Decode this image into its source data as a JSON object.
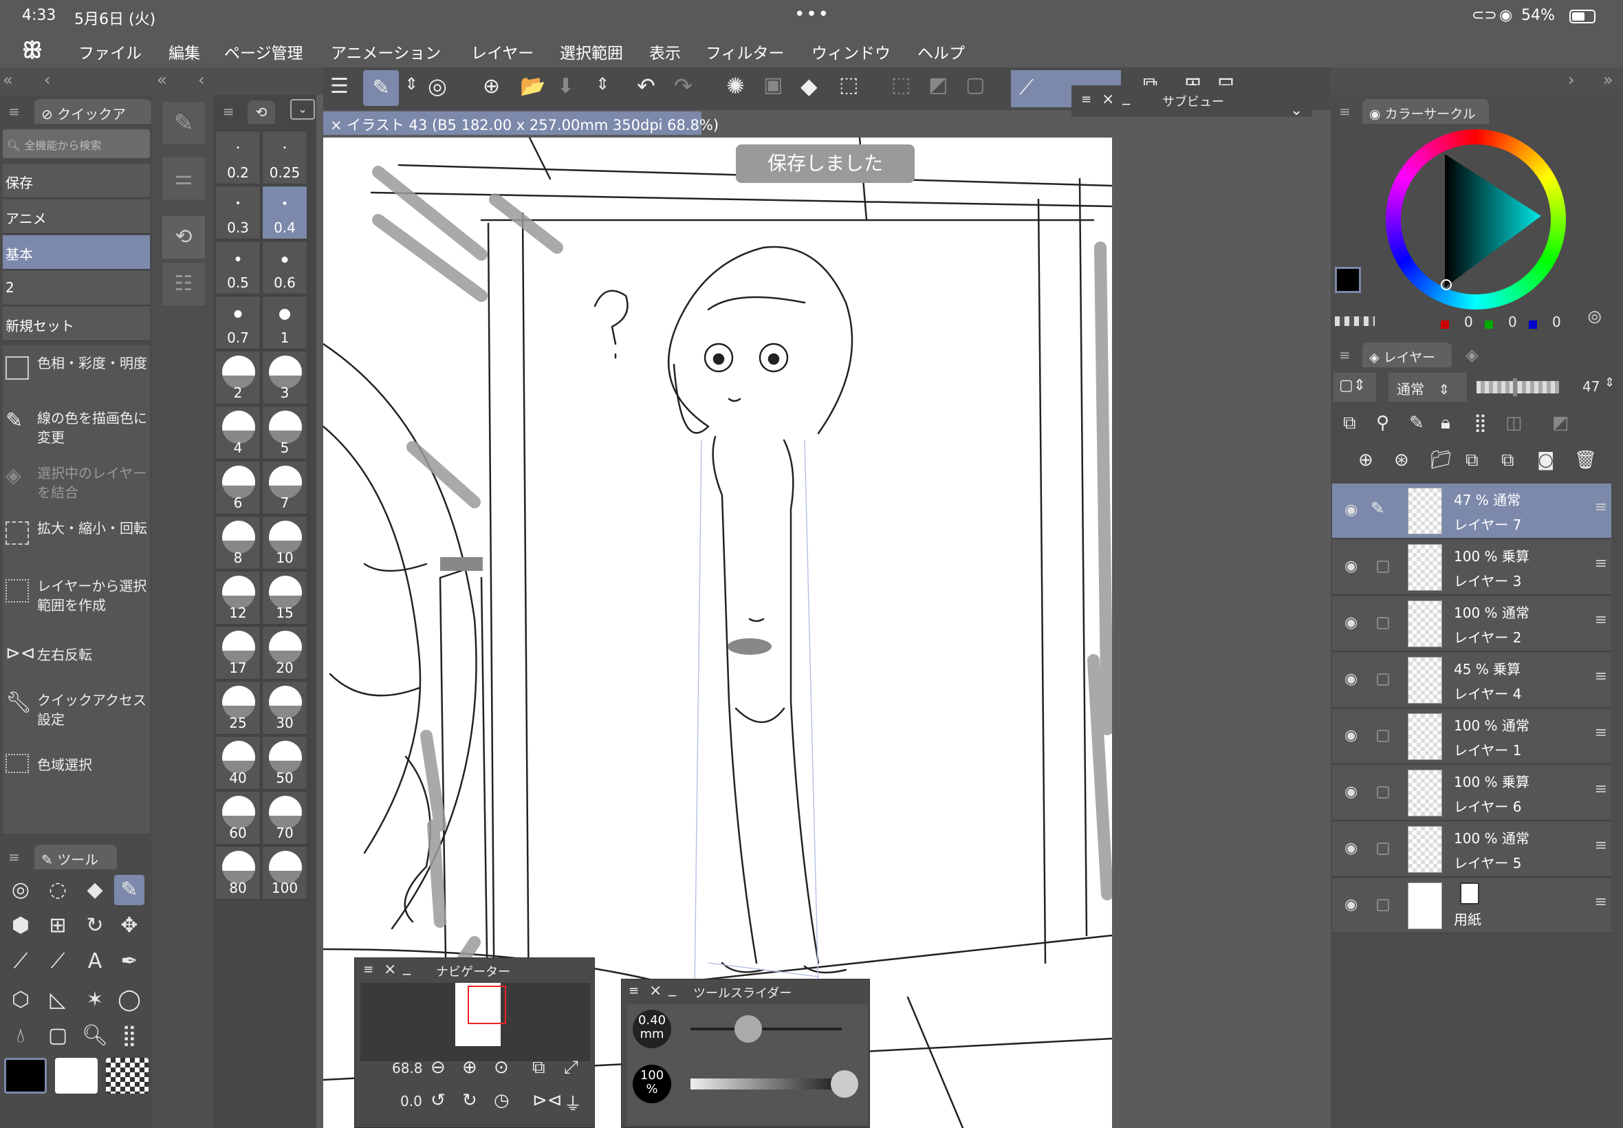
{
  "status": {
    "time": "4:33",
    "date": "5月6日 (火)",
    "battery": "54%"
  },
  "menu": [
    "ファイル",
    "編集",
    "ページ管理",
    "アニメーション",
    "レイヤー",
    "選択範囲",
    "表示",
    "フィルター",
    "ウィンドウ",
    "ヘルプ"
  ],
  "quick_access": {
    "title": "クイックア",
    "search_placeholder": "全機能から検索",
    "sets": [
      "保存",
      "アニメ",
      "基本",
      "2",
      "新規セット"
    ],
    "selected_set": "基本",
    "commands": [
      "色相・彩度・明度",
      "線の色を描画色に変更",
      "選択中のレイヤーを結合",
      "拡大・縮小・回転",
      "レイヤーから選択範囲を作成",
      "左右反転",
      "クイックアクセス設定",
      "色域選択"
    ]
  },
  "tool_panel": {
    "title": "ツール"
  },
  "brush_sizes": [
    "0.2",
    "0.25",
    "0.3",
    "0.4",
    "0.5",
    "0.6",
    "0.7",
    "1",
    "2",
    "3",
    "4",
    "5",
    "6",
    "7",
    "8",
    "10",
    "12",
    "15",
    "17",
    "20",
    "25",
    "30",
    "40",
    "50",
    "60",
    "70",
    "80",
    "100"
  ],
  "selected_brush_size": "0.4",
  "canvas": {
    "tab_title": "イラスト 43 (B5 182.00 x 257.00mm 350dpi 68.8%)",
    "toast": "保存しました"
  },
  "subview": {
    "title": "サブビュー"
  },
  "navigator": {
    "title": "ナビゲーター",
    "zoom": "68.8",
    "rotation": "0.0"
  },
  "tool_slider": {
    "title": "ツールスライダー",
    "size_value": "0.40",
    "size_unit": "mm",
    "opacity_value": "100",
    "opacity_unit": "%",
    "size_fraction": 0.38,
    "opacity_fraction": 1.0
  },
  "color_circle": {
    "title": "カラーサークル",
    "r": "0",
    "g": "0",
    "b": "0",
    "main_color": "#000000",
    "sub_color": "#ffffff"
  },
  "layer_panel": {
    "title": "レイヤー",
    "blend_mode": "通常",
    "opacity": "47",
    "layers": [
      {
        "mode": "47 % 通常",
        "name": "レイヤー 7"
      },
      {
        "mode": "100 % 乗算",
        "name": "レイヤー 3"
      },
      {
        "mode": "100 % 通常",
        "name": "レイヤー 2"
      },
      {
        "mode": "45 % 乗算",
        "name": "レイヤー 4"
      },
      {
        "mode": "100 % 通常",
        "name": "レイヤー 1"
      },
      {
        "mode": "100 % 乗算",
        "name": "レイヤー 6"
      },
      {
        "mode": "100 % 通常",
        "name": "レイヤー 5"
      },
      {
        "mode": "",
        "name": "用紙"
      }
    ]
  }
}
